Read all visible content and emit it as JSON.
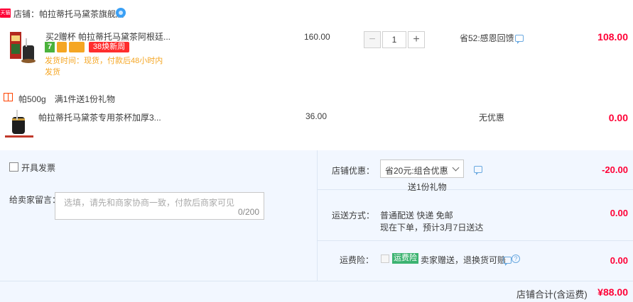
{
  "store": {
    "badge": "天猫",
    "name": "店铺：帕拉蒂托马黛茶旗舰店"
  },
  "items": [
    {
      "title": "买2赠杯 帕拉蒂托马黛茶阿根廷...",
      "tags": [
        "7",
        "38焕新周"
      ],
      "delivery": "发货时间：现货，付款后48小时内发货",
      "price": "160.00",
      "quantity": "1",
      "discount": "省52:感恩回馈",
      "subtotal": "108.00"
    },
    {
      "title": "帕拉蒂托马黛茶专用茶杯加厚3...",
      "price": "36.00",
      "discount": "无优惠",
      "subtotal": "0.00"
    }
  ],
  "gift": {
    "text": "帕500g　满1件送1份礼物"
  },
  "summary": {
    "invoice_label": "开具发票",
    "note_label": "给卖家留言：",
    "note_placeholder": "选填，请先和商家协商一致，付款后商家可见",
    "note_count": "0/200",
    "promo_label": "店铺优惠：",
    "promo_value": "省20元:组合优惠",
    "promo_sub": "送1份礼物",
    "promo_amount": "-20.00",
    "shipping_label": "运送方式：",
    "shipping_line1": "普通配送 快递 免邮",
    "shipping_line2": "现在下单，预计3月7日送达",
    "shipping_amount": "0.00",
    "insurance_label": "运费险：",
    "insurance_badge": "运费险",
    "insurance_text": "卖家赠送，退换货可赔",
    "insurance_amount": "0.00",
    "total_label": "店铺合计(含运费)",
    "total_amount": "¥88.00"
  },
  "colors": {
    "accent_red": "#ff0036",
    "bottom_bg": "#f2f7ff",
    "delivery_orange": "#f5a623"
  }
}
